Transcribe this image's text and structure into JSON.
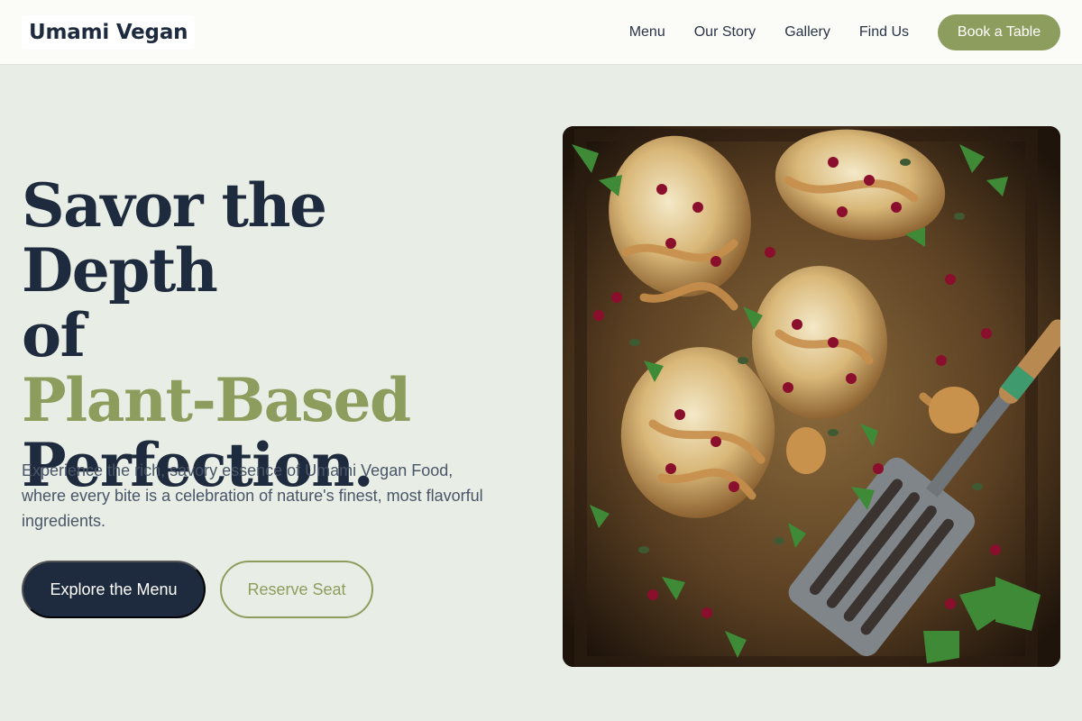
{
  "header": {
    "brand": "Umami Vegan",
    "nav": [
      "Menu",
      "Our Story",
      "Gallery",
      "Find Us"
    ],
    "cta": "Book a Table"
  },
  "hero": {
    "title_line1": "Savor the Depth",
    "title_line2": "of",
    "title_line3": "Plant-Based",
    "title_line4": "Perfection.",
    "subtitle": "Experience the rich, savory essence of Umami Vegan Food, where every bite is a celebration of nature's finest, most flavorful ingredients.",
    "primary_button": "Explore the Menu",
    "secondary_button": "Reserve Seat"
  },
  "colors": {
    "accent": "#8c9d5e",
    "navy": "#1e2a3d",
    "background": "#e8eee5"
  }
}
